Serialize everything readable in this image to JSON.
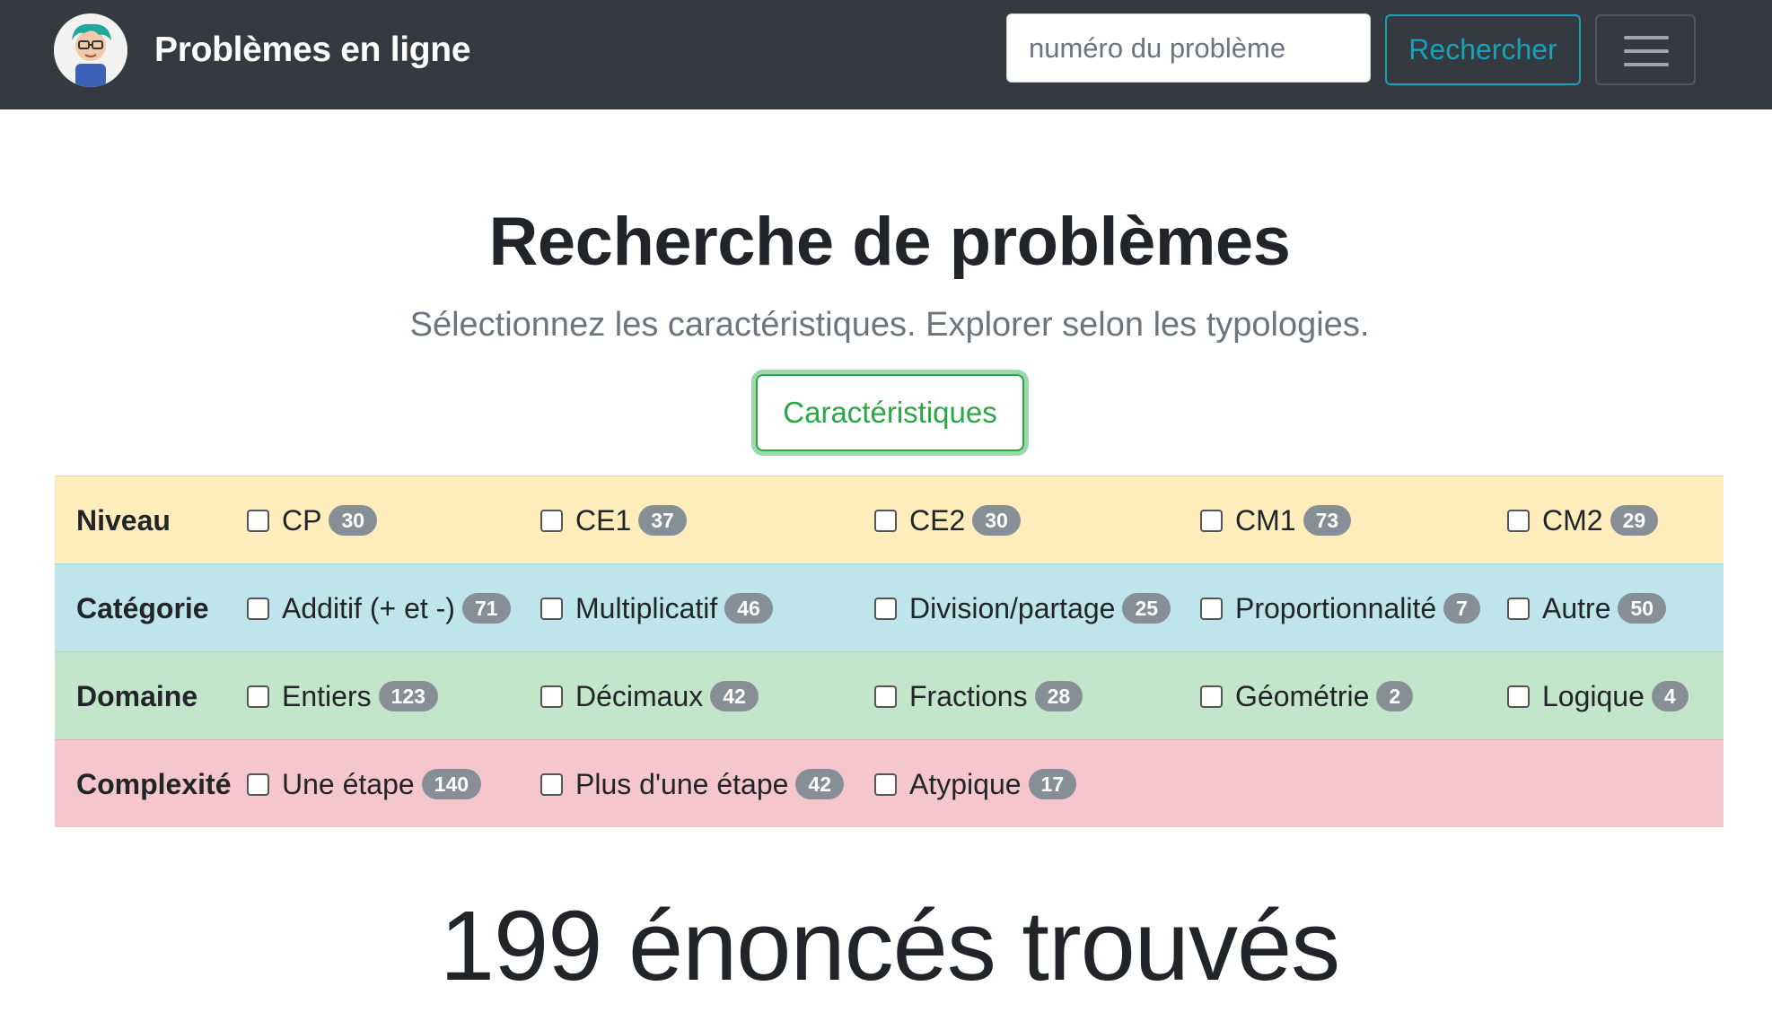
{
  "navbar": {
    "brand": "Problèmes en ligne",
    "search_placeholder": "numéro du problème",
    "search_button": "Rechercher"
  },
  "header": {
    "title": "Recherche de problèmes",
    "subtitle": "Sélectionnez les caractéristiques. Explorer selon les typologies.",
    "characteristics_button": "Caractéristiques"
  },
  "filters": {
    "niveau": {
      "label": "Niveau",
      "options": [
        {
          "label": "CP",
          "count": "30"
        },
        {
          "label": "CE1",
          "count": "37"
        },
        {
          "label": "CE2",
          "count": "30"
        },
        {
          "label": "CM1",
          "count": "73"
        },
        {
          "label": "CM2",
          "count": "29"
        }
      ]
    },
    "categorie": {
      "label": "Catégorie",
      "options": [
        {
          "label": "Additif (+ et -)",
          "count": "71"
        },
        {
          "label": "Multiplicatif",
          "count": "46"
        },
        {
          "label": "Division/partage",
          "count": "25"
        },
        {
          "label": "Proportionnalité",
          "count": "7"
        },
        {
          "label": "Autre",
          "count": "50"
        }
      ]
    },
    "domaine": {
      "label": "Domaine",
      "options": [
        {
          "label": "Entiers",
          "count": "123"
        },
        {
          "label": "Décimaux",
          "count": "42"
        },
        {
          "label": "Fractions",
          "count": "28"
        },
        {
          "label": "Géométrie",
          "count": "2"
        },
        {
          "label": "Logique",
          "count": "4"
        }
      ]
    },
    "complexite": {
      "label": "Complexité",
      "options": [
        {
          "label": "Une étape",
          "count": "140"
        },
        {
          "label": "Plus d'une étape",
          "count": "42"
        },
        {
          "label": "Atypique",
          "count": "17"
        }
      ]
    }
  },
  "results": {
    "text": "199 énoncés trouvés"
  }
}
